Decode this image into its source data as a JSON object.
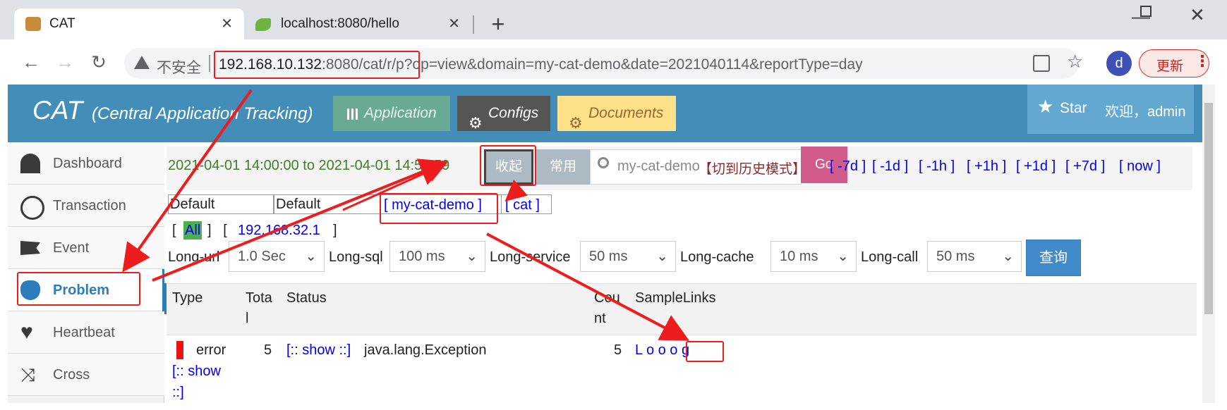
{
  "browser": {
    "tabs": [
      {
        "title": "CAT",
        "close": "✕"
      },
      {
        "title": "localhost:8080/hello",
        "close": "✕"
      }
    ],
    "new_tab": "+",
    "window_controls": {
      "minimize": "—",
      "maximize": "☐",
      "close": "✕"
    },
    "nav": {
      "back": "←",
      "forward": "→",
      "reload": "↻"
    },
    "security_label": "不安全",
    "url_host": "192.168.10.132",
    "url_rest": ":8080/cat/r/p?op=view&domain=my-cat-demo&date=2021040114&reportType=day",
    "profile_initial": "d",
    "update_label": "更新"
  },
  "header": {
    "logo": "CAT",
    "subtitle": "(Central Application Tracking)",
    "buttons": {
      "application": "Application",
      "configs": "Configs",
      "documents": "Documents"
    },
    "star": "Star",
    "welcome": "欢迎，admin"
  },
  "sidebar": {
    "items": [
      {
        "label": "Dashboard",
        "icon": "dashboard-icon"
      },
      {
        "label": "Transaction",
        "icon": "clock-icon"
      },
      {
        "label": "Event",
        "icon": "flag-icon"
      },
      {
        "label": "Problem",
        "icon": "bug-icon"
      },
      {
        "label": "Heartbeat",
        "icon": "heart-icon"
      },
      {
        "label": "Cross",
        "icon": "shuffle-icon"
      }
    ],
    "active": "Problem"
  },
  "report": {
    "time_range": "2021-04-01 14:00:00 to 2021-04-01 14:59:59",
    "collapse_btn": "收起",
    "common_btn": "常用",
    "search_placeholder": "my-cat-demo",
    "history_mode": "【切到历史模式】",
    "go_btn": "Go",
    "nav_links": [
      "[ -7d ]",
      "[ -1d ]",
      "[ -1h ]",
      "[ +1h ]",
      "[ +1d ]",
      "[ +7d ]",
      "[ now ]"
    ],
    "domain_row": {
      "group1": "Default",
      "group2": "Default",
      "link1": "[ my-cat-demo ]",
      "link2": "[ cat ]"
    },
    "ip_row": {
      "open": "[",
      "all": "All",
      "mid": "]   [",
      "ip": "192.168.32.1",
      "close": "]"
    },
    "filters": [
      {
        "label": "Long-url",
        "value": "1.0 Sec"
      },
      {
        "label": "Long-sql",
        "value": "100 ms"
      },
      {
        "label": "Long-service",
        "value": "50 ms"
      },
      {
        "label": "Long-cache",
        "value": "10 ms"
      },
      {
        "label": "Long-call",
        "value": "50 ms"
      }
    ],
    "query_btn": "查询",
    "table": {
      "headers": {
        "type": "Type",
        "total1": "Tota",
        "total2": "l",
        "status": "Status",
        "count1": "Cou",
        "count2": "nt",
        "samples": "SampleLinks"
      },
      "row": {
        "type": "error",
        "total": "5",
        "show_link": "[:: show ::]",
        "status": "java.lang.Exception",
        "count": "5",
        "samples": "L o o o g",
        "type_show1": "[:: show",
        "type_show2": "::]"
      }
    }
  },
  "colors": {
    "accent": "#438eb9",
    "annotation": "#ee1c1c",
    "link": "#0000ee"
  }
}
